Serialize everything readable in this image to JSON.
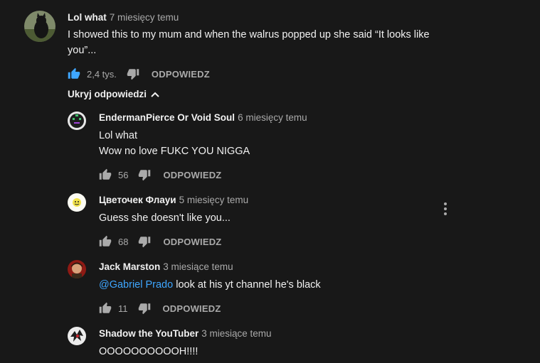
{
  "main_comment": {
    "author": "Lol what",
    "time": "7 miesięcy temu",
    "text": "I showed this to my mum and when the walrus popped up she said “It looks like you”...",
    "likes": "2,4 tys.",
    "reply_label": "ODPOWIEDZ",
    "liked": true
  },
  "hide_replies_label": "Ukryj odpowiedzi",
  "replies": [
    {
      "author": "EndermanPierce Or Void Soul",
      "time": "6 miesięcy temu",
      "text_lines": [
        "Lol what",
        "Wow no love FUKC YOU NIGGA"
      ],
      "likes": "56",
      "reply_label": "ODPOWIEDZ"
    },
    {
      "author": "Цветочек Флауи",
      "time": "5 miesięcy temu",
      "text_lines": [
        "Guess she doesn't like you..."
      ],
      "likes": "68",
      "reply_label": "ODPOWIEDZ"
    },
    {
      "author": "Jack Marston",
      "time": "3 miesiące temu",
      "mention": "@Gabriel Prado",
      "text_after_mention": " look at his yt channel he's black",
      "likes": "11",
      "reply_label": "ODPOWIEDZ"
    },
    {
      "author": "Shadow the YouTuber",
      "time": "3 miesiące temu",
      "text_lines": [
        "OOOOOOOOOOH!!!!"
      ]
    }
  ],
  "icons": {
    "like": "thumb-up-icon",
    "dislike": "thumb-down-icon",
    "more": "more-vert-icon",
    "chevron": "chevron-up-icon"
  },
  "colors": {
    "background": "#181818",
    "text": "#f1f1f1",
    "secondary": "#aaaaaa",
    "link": "#3ea6ff"
  }
}
